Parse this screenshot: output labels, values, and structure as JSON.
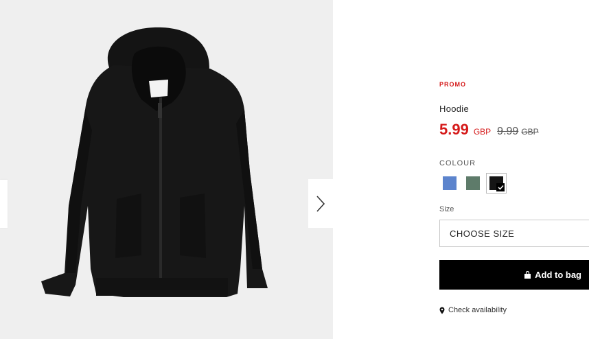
{
  "product": {
    "badge": "PROMO",
    "name": "Hoodie",
    "price": "5.99",
    "price_currency": "GBP",
    "old_price": "9.99",
    "old_price_currency": "GBP",
    "image_alt": "Black zip-up hoodie"
  },
  "colour": {
    "label": "COLOUR",
    "options": [
      {
        "name": "blue",
        "hex": "#5c84cd"
      },
      {
        "name": "green",
        "hex": "#5e7b6a"
      },
      {
        "name": "black",
        "hex": "#151515",
        "selected": true
      }
    ]
  },
  "size": {
    "label": "Size",
    "select_text": "CHOOSE SIZE"
  },
  "actions": {
    "add_to_bag": "Add to bag",
    "check_availability": "Check availability"
  },
  "icons": {
    "next": "chevron-right-icon",
    "bag": "bag-icon",
    "pin": "location-pin-icon",
    "check": "check-icon"
  },
  "colors": {
    "promo_red": "#d51a1a",
    "button_black": "#000000",
    "gallery_bg": "#efefef"
  }
}
